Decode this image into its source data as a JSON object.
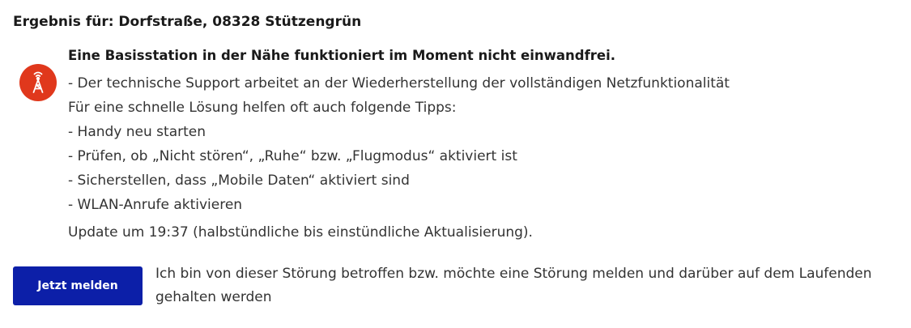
{
  "result": {
    "title": "Ergebnis für: Dorfstraße, 08328 Stützengrün"
  },
  "status": {
    "icon": "cell-tower-icon",
    "icon_color": "#e0381c",
    "headline": "Eine Basisstation in der Nähe funktioniert im Moment nicht einwandfrei.",
    "lines": [
      "- Der technische Support arbeitet an der Wiederherstellung der vollständigen Netzfunktionalität",
      "Für eine schnelle Lösung helfen oft auch folgende Tipps:",
      "- Handy neu starten",
      "- Prüfen, ob „Nicht stören“, „Ruhe“ bzw. „Flugmodus“ aktiviert ist",
      "- Sicherstellen, dass „Mobile Daten“ aktiviert sind",
      "- WLAN-Anrufe aktivieren"
    ],
    "update": "Update um 19:37 (halbstündliche bis einstündliche Aktualisierung)."
  },
  "report": {
    "button_label": "Jetzt melden",
    "button_color": "#0c1fa8",
    "description": "Ich bin von dieser Störung betroffen bzw. möchte eine Störung melden und darüber auf dem Laufenden gehalten werden"
  }
}
